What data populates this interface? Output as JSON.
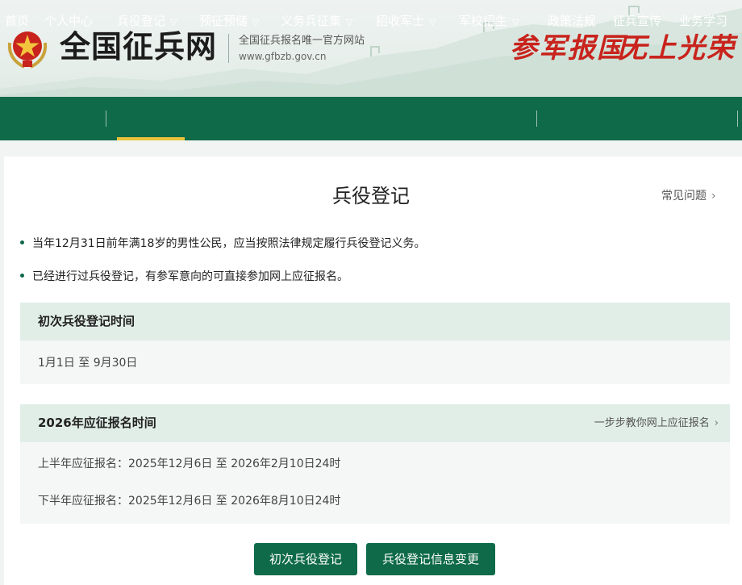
{
  "header": {
    "site_title": "全国征兵网",
    "site_subtitle": "全国征兵报名唯一官方网站",
    "site_url": "www.gfbzb.gov.cn",
    "slogan_1": "参军报国",
    "slogan_2": "无上光荣"
  },
  "nav": {
    "items": [
      {
        "label": "首页"
      },
      {
        "label": "个人中心"
      },
      {
        "label": "兵役登记"
      },
      {
        "label": "预征预储"
      },
      {
        "label": "义务兵征集"
      },
      {
        "label": "招收军士"
      },
      {
        "label": "军校招生"
      },
      {
        "label": "政策法规"
      },
      {
        "label": "征兵宣传"
      },
      {
        "label": "业务学习"
      }
    ],
    "active": "兵役登记",
    "chevron": "▽"
  },
  "page": {
    "title": "兵役登记",
    "faq_label": "常见问题",
    "bullets": [
      "当年12月31日前年满18岁的男性公民，应当按照法律规定履行兵役登记义务。",
      "已经进行过兵役登记，有参军意向的可直接参加网上应征报名。"
    ],
    "panel_1": {
      "title": "初次兵役登记时间",
      "rows": [
        "1月1日 至 9月30日"
      ]
    },
    "panel_2": {
      "title": "2026年应征报名时间",
      "link": "一步步教你网上应征报名",
      "rows": [
        "上半年应征报名：2025年12月6日 至 2026年2月10日24时",
        "下半年应征报名：2025年12月6日 至 2026年8月10日24时"
      ]
    },
    "buttons": {
      "first_registration": "初次兵役登记",
      "info_change": "兵役登记信息变更"
    }
  },
  "colors": {
    "brand_green": "#0e6a48",
    "active_underline": "#e8c23a",
    "slogan_red": "#c8231c"
  }
}
